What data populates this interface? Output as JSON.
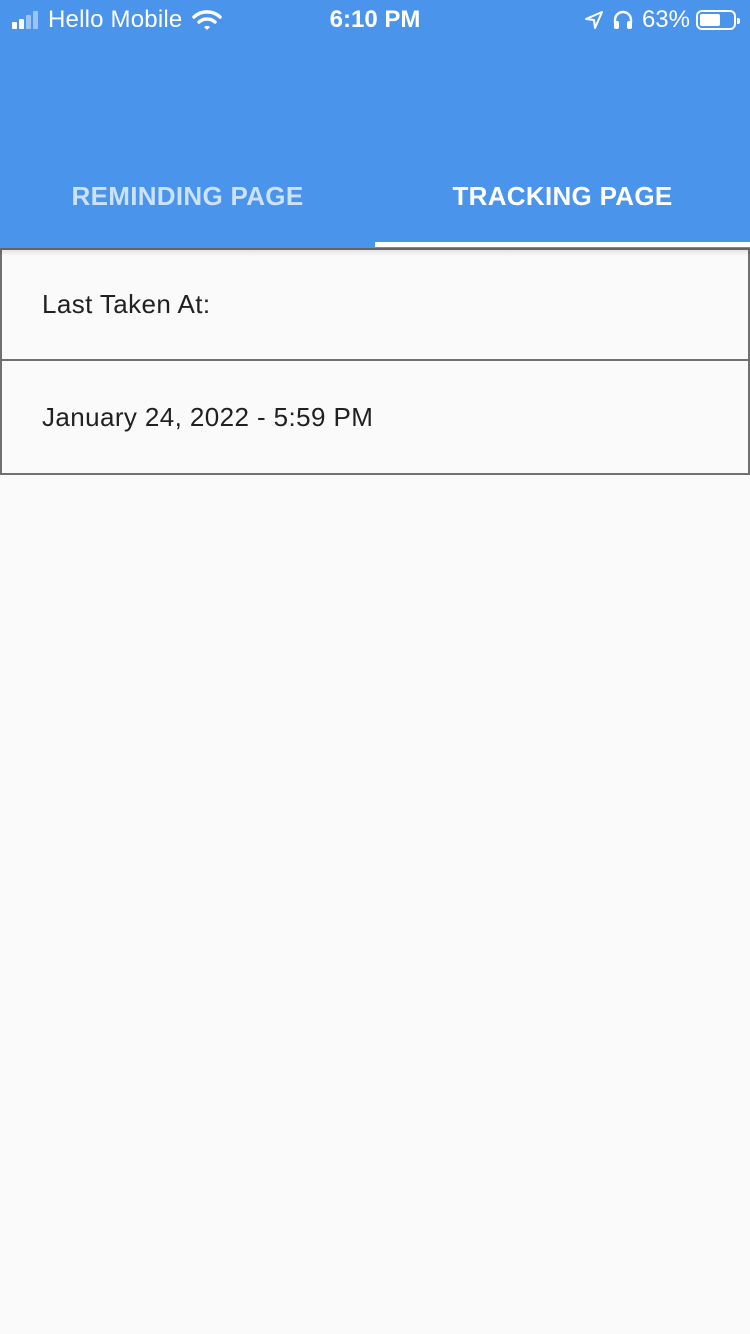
{
  "status_bar": {
    "carrier": "Hello Mobile",
    "time": "6:10 PM",
    "battery_percent_label": "63%",
    "battery_level": 0.63,
    "icons": [
      "signal-icon",
      "wifi-icon",
      "location-arrow-icon",
      "headphones-icon",
      "battery-icon"
    ]
  },
  "tabs": [
    {
      "label": "REMINDING PAGE",
      "selected": false
    },
    {
      "label": "TRACKING PAGE",
      "selected": true
    }
  ],
  "tracking": {
    "heading": "Last Taken At:",
    "last_taken_value": "January 24, 2022 - 5:59 PM"
  },
  "colors": {
    "app_bar": "#4a94eb",
    "background": "#fafafa",
    "row_border": "#707070",
    "text": "#212121"
  }
}
